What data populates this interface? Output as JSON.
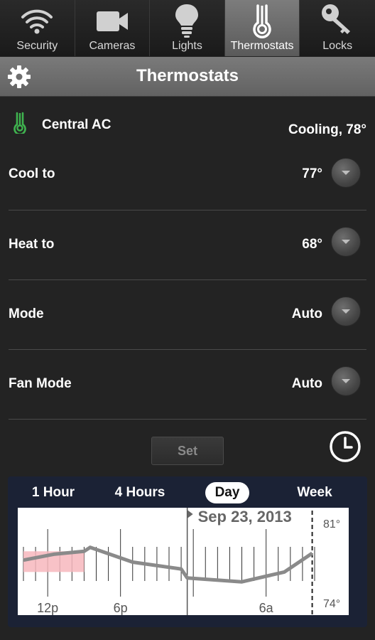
{
  "tabs": [
    {
      "label": "Security",
      "icon": "wifi-icon",
      "active": false
    },
    {
      "label": "Cameras",
      "icon": "camera-icon",
      "active": false
    },
    {
      "label": "Lights",
      "icon": "bulb-icon",
      "active": false
    },
    {
      "label": "Thermostats",
      "icon": "thermometer-icon",
      "active": true
    },
    {
      "label": "Locks",
      "icon": "key-icon",
      "active": false
    }
  ],
  "header": {
    "title": "Thermostats"
  },
  "device": {
    "name": "Central AC",
    "status": "Cooling, 78°",
    "icon_color": "#3fb34f"
  },
  "settings": [
    {
      "label": "Cool to",
      "value": "77°"
    },
    {
      "label": "Heat to",
      "value": "68°"
    },
    {
      "label": "Mode",
      "value": "Auto"
    },
    {
      "label": "Fan Mode",
      "value": "Auto"
    }
  ],
  "set_label": "Set",
  "ranges": [
    {
      "label": "1 Hour",
      "active": false
    },
    {
      "label": "4 Hours",
      "active": false
    },
    {
      "label": "Day",
      "active": true
    },
    {
      "label": "Week",
      "active": false
    }
  ],
  "chart_data": {
    "type": "line",
    "date_label": "Sep 23, 2013",
    "x_tick_labels": [
      "12p",
      "6p",
      "6a"
    ],
    "y_labels": {
      "top": "81°",
      "bottom": "74°"
    },
    "ylim": [
      74,
      81
    ],
    "hours_span": 24,
    "series": [
      {
        "x_hours": [
          0,
          2.5,
          5,
          5.5,
          9,
          13,
          13.5,
          18,
          21.5,
          23.8
        ],
        "values": [
          77.7,
          78.3,
          78.6,
          79.0,
          77.5,
          76.8,
          75.9,
          75.5,
          76.5,
          78.4
        ]
      }
    ],
    "cooling_band": {
      "x_hours_start": 0,
      "x_hours_end": 5,
      "top": 78.6,
      "bottom": 76.5,
      "color": "#f7b7bd"
    },
    "marker_hour": 13.5,
    "now_hour": 23.8
  }
}
